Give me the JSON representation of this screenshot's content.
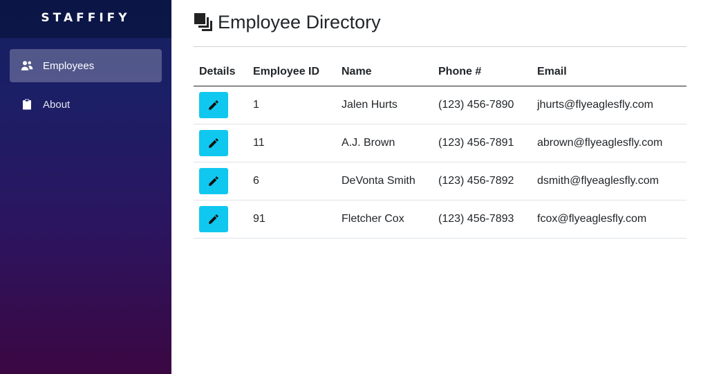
{
  "app": {
    "brand": "STAFFIFY"
  },
  "sidebar": {
    "items": [
      {
        "label": "Employees",
        "icon": "users-icon",
        "active": true
      },
      {
        "label": "About",
        "icon": "clipboard-icon",
        "active": false
      }
    ]
  },
  "page": {
    "title": "Employee Directory",
    "icon": "clone-icon"
  },
  "table": {
    "headers": [
      "Details",
      "Employee ID",
      "Name",
      "Phone #",
      "Email"
    ],
    "rows": [
      {
        "id": "1",
        "name": "Jalen Hurts",
        "phone": "(123) 456-7890",
        "email": "jhurts@flyeaglesfly.com"
      },
      {
        "id": "11",
        "name": "A.J. Brown",
        "phone": "(123) 456-7891",
        "email": "abrown@flyeaglesfly.com"
      },
      {
        "id": "6",
        "name": "DeVonta Smith",
        "phone": "(123) 456-7892",
        "email": "dsmith@flyeaglesfly.com"
      },
      {
        "id": "91",
        "name": "Fletcher Cox",
        "phone": "(123) 456-7893",
        "email": "fcox@flyeaglesfly.com"
      }
    ],
    "edit_icon": "pencil-icon"
  },
  "colors": {
    "accent": "#10c7ef",
    "sidebar_top": "#14205f",
    "sidebar_bottom": "#3b0742"
  }
}
